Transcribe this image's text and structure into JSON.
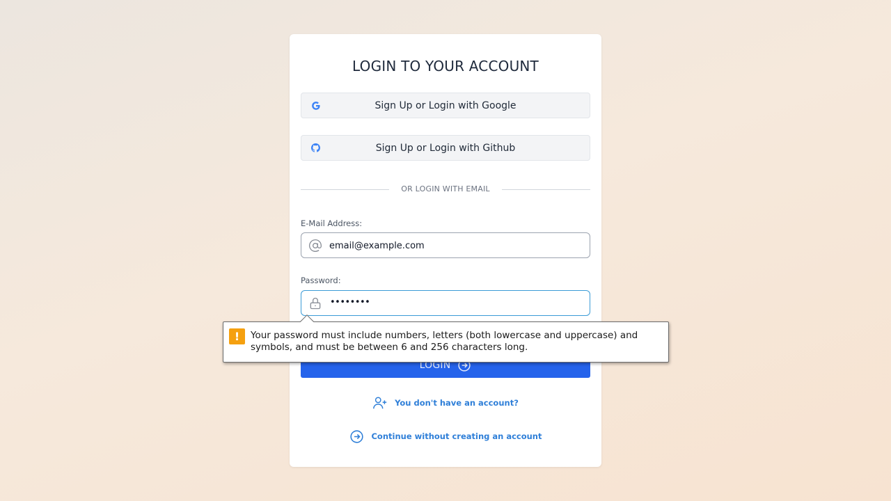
{
  "login": {
    "title": "LOGIN TO YOUR ACCOUNT",
    "google_button": "Sign Up or Login with Google",
    "github_button": "Sign Up or Login with Github",
    "divider_text": "OR LOGIN WITH EMAIL",
    "email_label": "E-Mail Address:",
    "email_value": "email@example.com",
    "password_label": "Password:",
    "password_display": "••••••••",
    "login_button": "LOGIN",
    "signup_link": "You don't have an account?",
    "continue_link": "Continue without creating an account"
  },
  "tooltip": {
    "icon": "!",
    "message": "Your password must include numbers, letters (both lowercase and uppercase) and symbols, and must be between 6 and 256 characters long."
  },
  "icons": {
    "google": "google-icon",
    "github": "github-icon",
    "email": "at-sign-icon",
    "password": "lock-icon",
    "login": "arrow-right-circle-icon",
    "signup": "user-plus-icon",
    "continue": "arrow-right-circle-icon",
    "warning": "warning-icon"
  },
  "colors": {
    "primary": "#2563eb",
    "link": "#2f7fd8",
    "warning": "#f5a00f"
  }
}
